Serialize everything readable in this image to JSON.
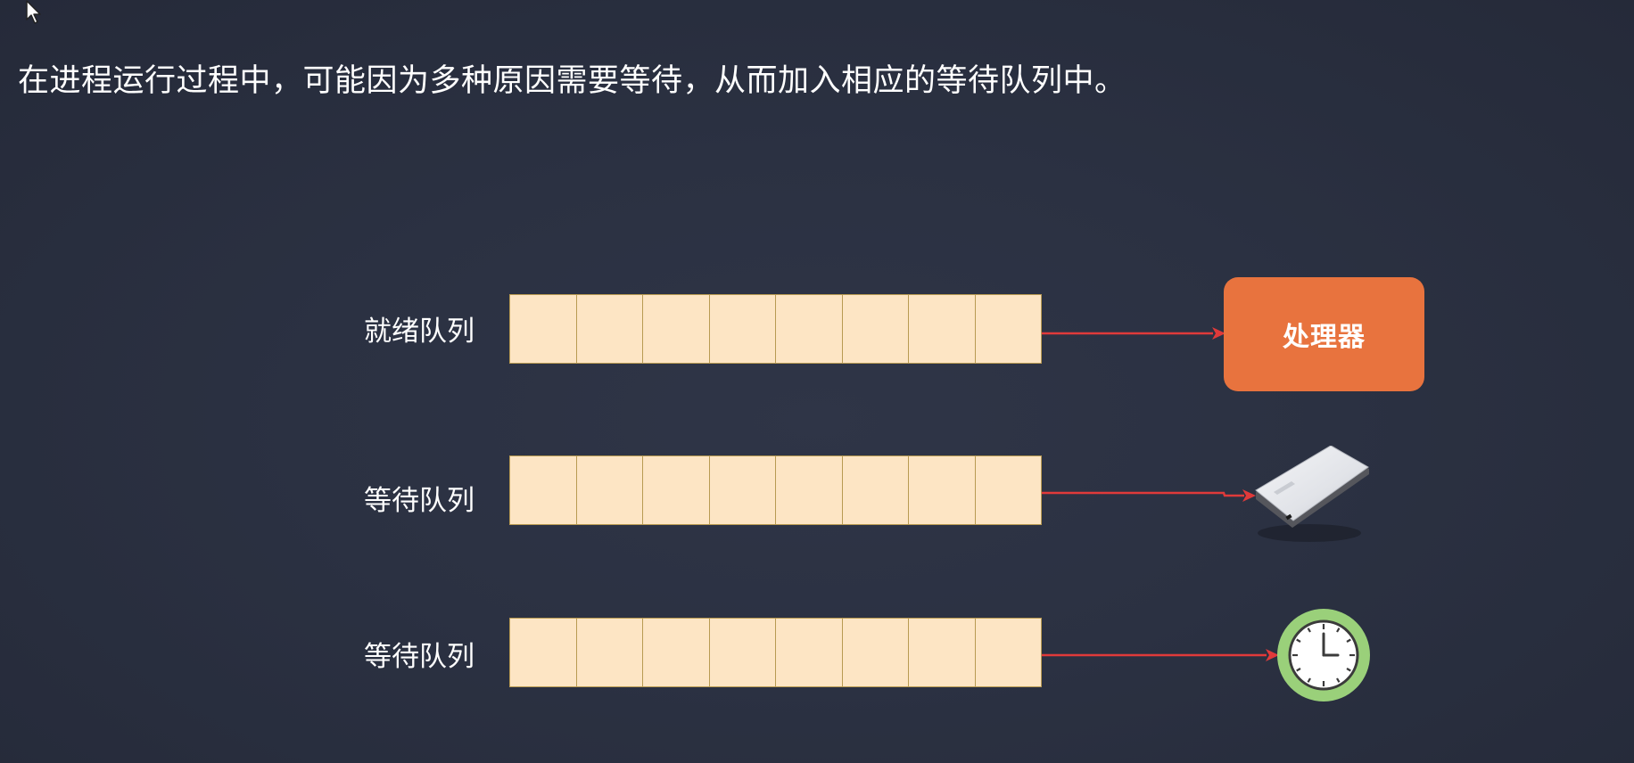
{
  "heading": "在进程运行过程中，可能因为多种原因需要等待，从而加入相应的等待队列中。",
  "queues": [
    {
      "label": "就绪队列",
      "slots": 8
    },
    {
      "label": "等待队列",
      "slots": 8
    },
    {
      "label": "等待队列",
      "slots": 8
    }
  ],
  "processor": {
    "label": "处理器"
  },
  "devices": [
    "hard-disk-icon",
    "clock-icon"
  ],
  "colors": {
    "background": "#2b3142",
    "slot_fill": "#fde5c4",
    "slot_border": "#b89a52",
    "arrow": "#e03a3a",
    "processor": "#e8733e",
    "clock_ring": "#9ad07a"
  }
}
